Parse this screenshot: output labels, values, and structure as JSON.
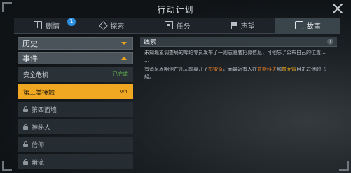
{
  "window": {
    "title": "行动计划"
  },
  "tabs": [
    {
      "label": "剧情",
      "icon": "book-icon",
      "badge": "1"
    },
    {
      "label": "探索",
      "icon": "explore-icon"
    },
    {
      "label": "任务",
      "icon": "task-icon"
    },
    {
      "label": "声望",
      "icon": "flag-icon"
    },
    {
      "label": "故事",
      "icon": "story-icon",
      "active": true
    }
  ],
  "sidebar": {
    "history_label": "历史",
    "events_label": "事件",
    "items": [
      {
        "label": "安全危机",
        "status": "已完成"
      },
      {
        "label": "第三类接触",
        "status": "0/4",
        "active": true
      },
      {
        "label": "第四面墙",
        "locked": true
      },
      {
        "label": "神秘人",
        "locked": true
      },
      {
        "label": "信仰",
        "locked": true
      },
      {
        "label": "暗流",
        "locked": true
      }
    ]
  },
  "clue": {
    "header": "线索",
    "info_glyph": "i",
    "p1": "未知现象调查局的库珀专员发布了一则志愿者招募信息，可他忘了公布自己的位置…",
    "p1_ellipsis": "…",
    "p2_prefix": "有消息表明他在几天前离开了",
    "p2_place": "布雷奇",
    "p2_mid": "，而最近有人在",
    "p2_person1": "普斯科夫",
    "p2_and": "和",
    "p2_person2": "普乔雷",
    "p2_suffix": "目击过他的飞船。"
  },
  "colors": {
    "accent": "#f0a722",
    "completed": "#5fb64d",
    "highlight_gold": "#e6a41c",
    "highlight_orange": "#e07b28"
  }
}
